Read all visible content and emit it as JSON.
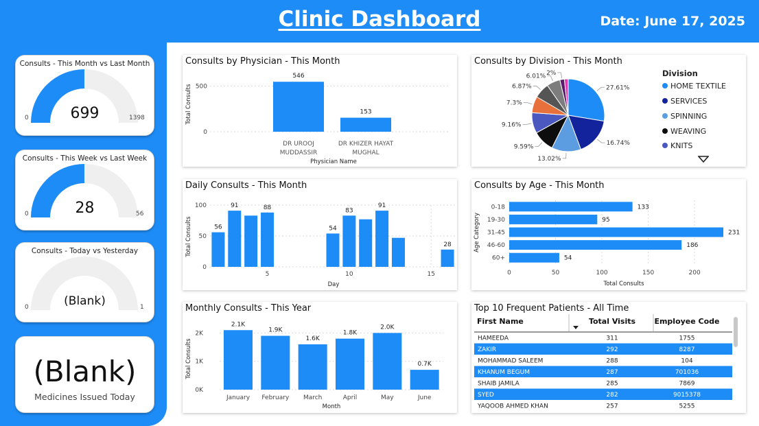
{
  "header": {
    "title": "Clinic Dashboard",
    "date": "Date: June 17, 2025"
  },
  "kpis": {
    "month": {
      "title": "Consults - This Month vs Last Month",
      "value": "699",
      "min": "0",
      "max": "1398",
      "fraction": 0.5
    },
    "week": {
      "title": "Consults - This Week vs Last Week",
      "value": "28",
      "min": "0",
      "max": "56",
      "fraction": 0.5
    },
    "today": {
      "title": "Consults - Today vs Yesterday",
      "value": "(Blank)",
      "min": "0",
      "max": "1",
      "fraction": 0
    },
    "medicines": {
      "value": "(Blank)",
      "label": "Medicines Issued Today"
    }
  },
  "colors": {
    "accent": "#1e8cf7",
    "track": "#efefef"
  },
  "chart_data": [
    {
      "id": "physician",
      "type": "bar",
      "title": "Consults by Physician - This Month",
      "xlabel": "Physician Name",
      "ylabel": "Total Consults",
      "categories": [
        [
          "DR UROOJ",
          "MUDDASSIR"
        ],
        [
          "DR KHIZER HAYAT",
          "MUGHAL"
        ]
      ],
      "values": [
        546,
        153
      ],
      "ylim": [
        0,
        600
      ],
      "yticks": [
        0,
        500
      ],
      "grid": true
    },
    {
      "id": "division",
      "type": "pie",
      "title": "Consults by Division - This Month",
      "legend_title": "Division",
      "legend": [
        "HOME TEXTILE",
        "SERVICES",
        "SPINNING",
        "WEAVING",
        "KNITS"
      ],
      "slices": [
        {
          "label": "27.61%",
          "value": 27.61,
          "color": "#1e8cf7"
        },
        {
          "label": "16.74%",
          "value": 16.74,
          "color": "#13239c"
        },
        {
          "label": "13.02%",
          "value": 13.02,
          "color": "#5b9de0"
        },
        {
          "label": "9.59%",
          "value": 9.59,
          "color": "#0d0d0d"
        },
        {
          "label": "9.16%",
          "value": 9.16,
          "color": "#4a58c0"
        },
        {
          "label": "7.3%",
          "value": 7.3,
          "color": "#e8703a"
        },
        {
          "label": "6.87%",
          "value": 6.87,
          "color": "#555555"
        },
        {
          "label": "6.01%",
          "value": 6.01,
          "color": "#7d7d7d"
        },
        {
          "label": "2%",
          "value": 2.0,
          "color": "#5c1a6e"
        },
        {
          "label": "",
          "value": 1.7,
          "color": "#e03cb0"
        }
      ]
    },
    {
      "id": "daily",
      "type": "bar",
      "title": "Daily Consults - This Month",
      "xlabel": "Day",
      "ylabel": "Total Consults",
      "x": [
        2,
        3,
        4,
        5,
        9,
        10,
        11,
        12,
        13,
        14,
        16
      ],
      "values": [
        56,
        91,
        83,
        88,
        54,
        83,
        77,
        91,
        47,
        0,
        28
      ],
      "data_labels": [
        "56",
        "91",
        "",
        "88",
        "54",
        "83",
        "",
        "91",
        "",
        "",
        "28"
      ],
      "xlim": [
        1.5,
        16.5
      ],
      "xticks": [
        5,
        10,
        15
      ],
      "ylim": [
        0,
        100
      ],
      "yticks": [
        0,
        50,
        100
      ],
      "grid": true
    },
    {
      "id": "age",
      "type": "bar",
      "orientation": "horizontal",
      "title": "Consults by Age - This Month",
      "xlabel": "Total Consults",
      "ylabel": "Age Category",
      "categories": [
        "0-18",
        "19-30",
        "31-45",
        "46-60",
        "60+"
      ],
      "values": [
        133,
        95,
        231,
        186,
        54
      ],
      "xlim": [
        0,
        231
      ],
      "xticks": [
        0,
        50,
        100,
        150,
        200
      ],
      "grid": true
    },
    {
      "id": "monthly",
      "type": "bar",
      "title": "Monthly Consults - This Year",
      "xlabel": "Month",
      "ylabel": "Total Consults",
      "categories": [
        "January",
        "February",
        "March",
        "April",
        "May",
        "June"
      ],
      "values": [
        2100,
        1900,
        1600,
        1800,
        2000,
        700
      ],
      "data_labels": [
        "2.1K",
        "1.9K",
        "1.6K",
        "1.8K",
        "2.0K",
        "0.7K"
      ],
      "ylim": [
        0,
        2300
      ],
      "yticks": [
        0,
        1000,
        2000
      ],
      "ytick_labels": [
        "0K",
        "1K",
        "2K"
      ],
      "grid": true
    },
    {
      "id": "patients",
      "type": "table",
      "title": "Top 10 Frequent Patients - All Time",
      "columns": [
        "First Name",
        "Total Visits",
        "Employee Code"
      ],
      "rows": [
        [
          "HAMEEDA",
          "311",
          "1755"
        ],
        [
          "ZAKIR",
          "292",
          "8287"
        ],
        [
          "MOHAMMAD SALEEM",
          "288",
          "104"
        ],
        [
          "KHANUM BEGUM",
          "287",
          "701036"
        ],
        [
          "SHAIB JAMILA",
          "285",
          "7869"
        ],
        [
          "SYED",
          "282",
          "9015378"
        ],
        [
          "YAQOOB AHMED KHAN",
          "257",
          "5255"
        ]
      ],
      "highlighted_rows": [
        1,
        3,
        5
      ]
    }
  ]
}
